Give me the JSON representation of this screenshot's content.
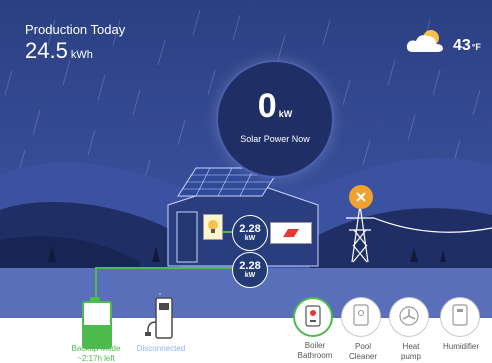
{
  "production": {
    "label": "Production Today",
    "value": "24.5",
    "unit": "kWh"
  },
  "weather": {
    "icon": "cloud-icon",
    "temperature": "43",
    "unit": "°F"
  },
  "solar": {
    "value": "0",
    "unit": "kW",
    "label": "Solar Power Now"
  },
  "home_flow": {
    "value": "2.28",
    "unit": "kW"
  },
  "battery_flow": {
    "value": "2.28",
    "unit": "kW"
  },
  "grid": {
    "status_icon": "close-icon"
  },
  "battery": {
    "percent_label": "50%",
    "level": 0.5,
    "mode": "Backup Mode",
    "time_left": "~2:17h left"
  },
  "ev_charger": {
    "status": "Disconnected"
  },
  "appliances": [
    {
      "name_line1": "Boiler",
      "name_line2": "Bathroom",
      "icon": "boiler-icon",
      "active": true
    },
    {
      "name_line1": "Pool",
      "name_line2": "Cleaner",
      "icon": "pool-cleaner-icon",
      "active": false
    },
    {
      "name_line1": "Heat",
      "name_line2": "pump",
      "icon": "heat-pump-icon",
      "active": false
    },
    {
      "name_line1": "Humidifier",
      "name_line2": "",
      "icon": "humidifier-icon",
      "active": false
    }
  ],
  "colors": {
    "sky": "#2a3d7e",
    "ground": "#5a6fb9",
    "accent_green": "#4cba4c",
    "grid_alert": "#f0a130",
    "disconnected": "#8ab4f8"
  }
}
